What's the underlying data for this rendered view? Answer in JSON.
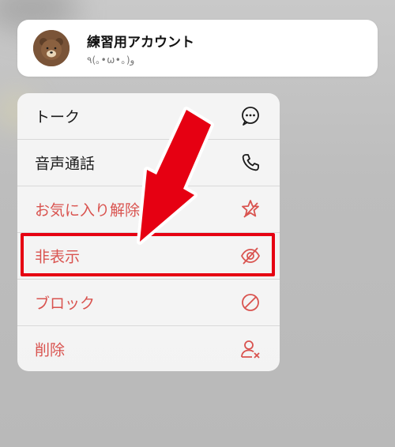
{
  "contact": {
    "name": "練習用アカウント",
    "status": "٩(｡•ω•｡)و",
    "avatar_icon": "bear-avatar-icon"
  },
  "menu": {
    "items": [
      {
        "label": "トーク",
        "icon": "chat-bubble-icon",
        "color": "#1a1a1a"
      },
      {
        "label": "音声通話",
        "icon": "phone-icon",
        "color": "#1a1a1a"
      },
      {
        "label": "お気に入り解除",
        "icon": "star-remove-icon",
        "color": "#d9534f"
      },
      {
        "label": "非表示",
        "icon": "eye-slash-icon",
        "color": "#d9534f"
      },
      {
        "label": "ブロック",
        "icon": "block-icon",
        "color": "#d9534f"
      },
      {
        "label": "削除",
        "icon": "person-remove-icon",
        "color": "#d9534f"
      }
    ]
  },
  "annotation": {
    "highlight_color": "#e60012",
    "arrow_color": "#e60012"
  }
}
